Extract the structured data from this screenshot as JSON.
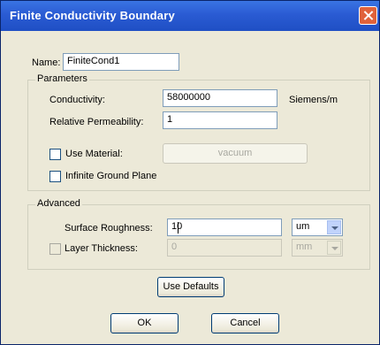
{
  "window": {
    "title": "Finite Conductivity Boundary"
  },
  "name": {
    "label": "Name:",
    "value": "FiniteCond1"
  },
  "parameters": {
    "legend": "Parameters",
    "conductivity": {
      "label": "Conductivity:",
      "value": "58000000",
      "unit": "Siemens/m"
    },
    "permeability": {
      "label": "Relative Permeability:",
      "value": "1"
    },
    "use_material": {
      "label": "Use Material:",
      "checked": false,
      "button": "vacuum"
    },
    "infinite_ground": {
      "label": "Infinite Ground Plane",
      "checked": false
    }
  },
  "advanced": {
    "legend": "Advanced",
    "roughness": {
      "label": "Surface Roughness:",
      "value": "10",
      "unit": "um"
    },
    "thickness": {
      "label": "Layer Thickness:",
      "checked": false,
      "value": "0",
      "unit": "mm"
    }
  },
  "buttons": {
    "defaults": "Use Defaults",
    "ok": "OK",
    "cancel": "Cancel"
  }
}
